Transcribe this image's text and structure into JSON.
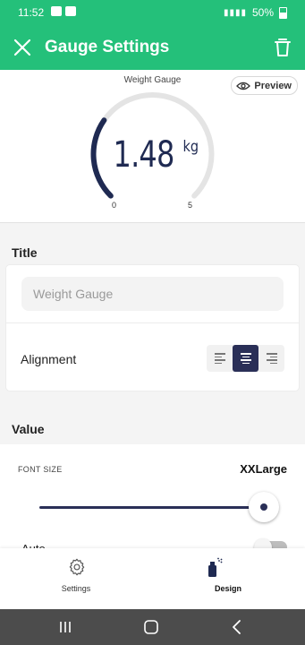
{
  "status_bar": {
    "time": "11:52",
    "battery": "50%"
  },
  "app_bar": {
    "title": "Gauge Settings"
  },
  "preview": {
    "widget_label": "Weight Gauge",
    "preview_button": "Preview",
    "gauge": {
      "value": "1.48",
      "unit": "kg",
      "min": "0",
      "max": "5",
      "fill_fraction": 0.296
    }
  },
  "title_section": {
    "heading": "Title",
    "input_placeholder": "Weight Gauge",
    "alignment_label": "Alignment",
    "alignment_selected": "center"
  },
  "value_section": {
    "heading": "Value",
    "font_size_label": "FONT SIZE",
    "font_size_value": "XXLarge",
    "slider_fraction": 1.0,
    "auto_label": "Auto",
    "auto_enabled": false
  },
  "bottom_nav": {
    "items": [
      {
        "label": "Settings",
        "icon": "gear-icon",
        "active": false
      },
      {
        "label": "Design",
        "icon": "paint-spray-icon",
        "active": true
      }
    ]
  },
  "colors": {
    "accent": "#24c07a",
    "gauge_fill": "#1f2a52",
    "gauge_track": "#e4e4e4"
  }
}
